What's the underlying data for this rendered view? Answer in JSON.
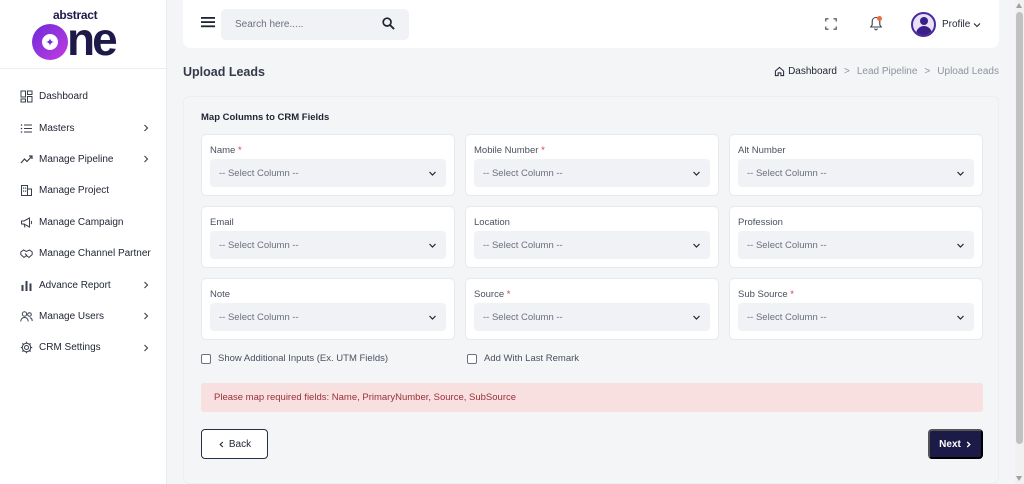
{
  "brand": {
    "logo_top": "abstract",
    "logo_bottom": "one"
  },
  "search": {
    "placeholder": "Search here....."
  },
  "header": {
    "profile_label": "Profile"
  },
  "sidebar": {
    "items": [
      {
        "label": "Dashboard",
        "icon": "dashboard-icon",
        "has_children": false
      },
      {
        "label": "Masters",
        "icon": "list-icon",
        "has_children": true
      },
      {
        "label": "Manage Pipeline",
        "icon": "pipeline-icon",
        "has_children": true
      },
      {
        "label": "Manage Project",
        "icon": "building-icon",
        "has_children": false
      },
      {
        "label": "Manage Campaign",
        "icon": "megaphone-icon",
        "has_children": false
      },
      {
        "label": "Manage Channel Partner",
        "icon": "handshake-icon",
        "has_children": false
      },
      {
        "label": "Advance Report",
        "icon": "bar-chart-icon",
        "has_children": true
      },
      {
        "label": "Manage Users",
        "icon": "users-icon",
        "has_children": true
      },
      {
        "label": "CRM Settings",
        "icon": "gear-icon",
        "has_children": true
      }
    ]
  },
  "page": {
    "title": "Upload Leads",
    "breadcrumb": {
      "home": "Dashboard",
      "separator": ">",
      "middle": "Lead Pipeline",
      "current": "Upload Leads"
    }
  },
  "form": {
    "title": "Map Columns to CRM Fields",
    "select_placeholder": "-- Select Column --",
    "fields": [
      {
        "label": "Name",
        "required": true,
        "value": "-- Select Column --"
      },
      {
        "label": "Mobile Number",
        "required": true,
        "value": "-- Select Column --"
      },
      {
        "label": "Alt Number",
        "required": false,
        "value": "-- Select Column --"
      },
      {
        "label": "Email",
        "required": false,
        "value": "-- Select Column --"
      },
      {
        "label": "Location",
        "required": false,
        "value": "-- Select Column --"
      },
      {
        "label": "Profession",
        "required": false,
        "value": "-- Select Column --"
      },
      {
        "label": "Note",
        "required": false,
        "value": "-- Select Column --"
      },
      {
        "label": "Source",
        "required": true,
        "value": "-- Select Column --"
      },
      {
        "label": "Sub Source",
        "required": true,
        "value": "-- Select Column --"
      }
    ],
    "required_mark": "*",
    "checkboxes": [
      {
        "label": "Show Additional Inputs (Ex. UTM Fields)",
        "checked": false
      },
      {
        "label": "Add With Last Remark",
        "checked": false
      }
    ],
    "alert": "Please map required fields: Name, PrimaryNumber, Source, SubSource",
    "back_label": "Back",
    "next_label": "Next"
  },
  "colors": {
    "primary": "#1c1a46",
    "alert_bg": "#f8e0e0",
    "alert_text": "#9a2f38",
    "required": "#d9364a",
    "notification_dot": "#f26b3a"
  }
}
